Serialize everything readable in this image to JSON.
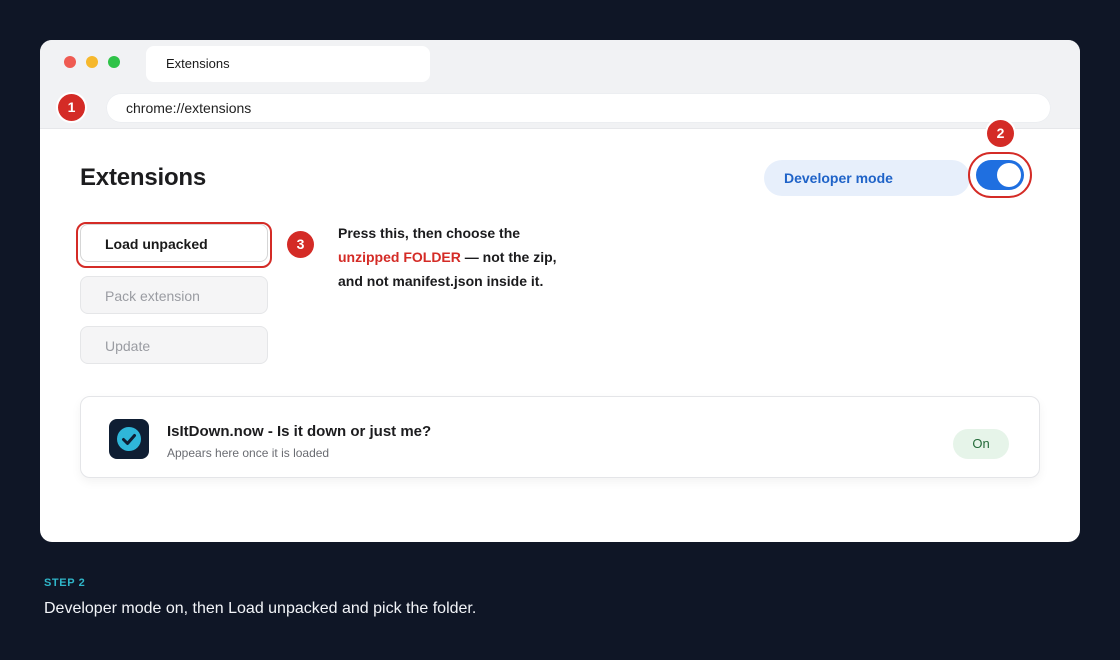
{
  "browser": {
    "tab_title": "Extensions",
    "address": "chrome://extensions"
  },
  "markers": {
    "one": "1",
    "two": "2",
    "three": "3"
  },
  "page": {
    "title": "Extensions",
    "developer_mode_label": "Developer mode",
    "developer_mode_on": true
  },
  "actions": {
    "load_unpacked": "Load unpacked",
    "pack_extension": "Pack extension",
    "update": "Update"
  },
  "instruction": {
    "line1": "Press this, then choose the",
    "highlight": "unzipped FOLDER",
    "line2_rest": " — not the zip,",
    "line3": "and not manifest.json inside it."
  },
  "extension": {
    "name": "IsItDown.now - Is it down or just me?",
    "subtitle": "Appears here once it is loaded",
    "status": "On",
    "icon": "check-circle-icon"
  },
  "step": {
    "label": "STEP 2",
    "description": "Developer mode on, then Load unpacked and pick the folder."
  },
  "colors": {
    "background": "#0f1626",
    "accent_red": "#d42b26",
    "toggle_blue": "#1f6fe0",
    "step_cyan": "#2fb6c9"
  }
}
